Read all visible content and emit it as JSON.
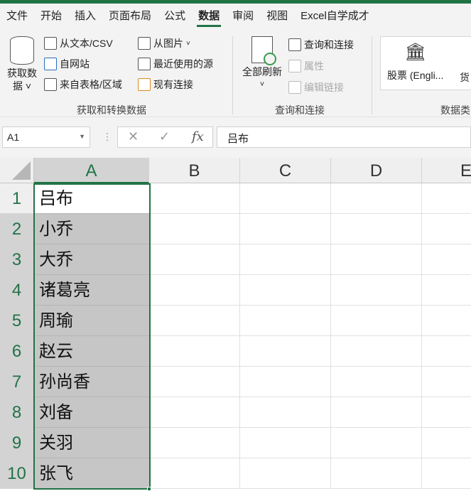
{
  "tabs": [
    "文件",
    "开始",
    "插入",
    "页面布局",
    "公式",
    "数据",
    "审阅",
    "视图",
    "Excel自学成才"
  ],
  "active_tab": "数据",
  "ribbon": {
    "get_data": "获取数",
    "get_data2": "据",
    "from_text": "从文本/CSV",
    "from_web": "自网站",
    "from_table": "来自表格/区域",
    "from_picture": "从图片",
    "recent_sources": "最近使用的源",
    "existing_connections": "现有连接",
    "group1": "获取和转换数据",
    "refresh_all": "全部刷新",
    "queries_connections": "查询和连接",
    "properties": "属性",
    "edit_links": "编辑链接",
    "group2": "查询和连接",
    "stocks": "股票 (Engli...",
    "currency": "货",
    "group3": "数据类"
  },
  "formula_bar": {
    "name_box": "A1",
    "cancel": "✕",
    "enter": "✓",
    "fx": "fx",
    "value": "吕布"
  },
  "columns": [
    "A",
    "B",
    "C",
    "D",
    "E"
  ],
  "rows": [
    "1",
    "2",
    "3",
    "4",
    "5",
    "6",
    "7",
    "8",
    "9",
    "10"
  ],
  "cells_A": [
    "吕布",
    "小乔",
    "大乔",
    "诸葛亮",
    "周瑜",
    "赵云",
    "孙尚香",
    "刘备",
    "关羽",
    "张飞"
  ]
}
